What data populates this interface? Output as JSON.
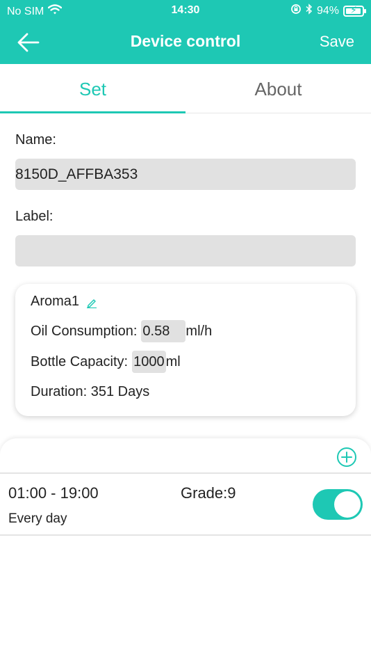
{
  "status_bar": {
    "carrier": "No SIM",
    "time": "14:30",
    "battery_percent": "94%",
    "battery_level": 0.94,
    "icons": [
      "wifi-icon",
      "rotation-lock-icon",
      "bluetooth-icon",
      "battery-charging-icon"
    ]
  },
  "nav": {
    "back_icon": "back-arrow-icon",
    "title": "Device control",
    "save_label": "Save"
  },
  "tabs": [
    {
      "label": "Set",
      "active": true
    },
    {
      "label": "About",
      "active": false
    }
  ],
  "form": {
    "name_label": "Name:",
    "name_value": "8150D_AFFBA353",
    "label_label": "Label:",
    "label_value": ""
  },
  "aroma": {
    "title": "Aroma1",
    "edit_icon": "pencil-icon",
    "oil_label": "Oil Consumption:",
    "oil_value": "0.58",
    "oil_unit": "ml/h",
    "capacity_label": "Bottle Capacity:",
    "capacity_value": "1000",
    "capacity_unit": "ml",
    "duration_text": "Duration: 351 Days"
  },
  "schedule": {
    "add_icon": "add-circle-icon",
    "items": [
      {
        "time_range": "01:00 - 19:00",
        "repeat": "Every day",
        "grade": "Grade:9",
        "enabled": true
      }
    ]
  },
  "colors": {
    "accent": "#1ec8b4",
    "field_bg": "#e1e1e1"
  }
}
